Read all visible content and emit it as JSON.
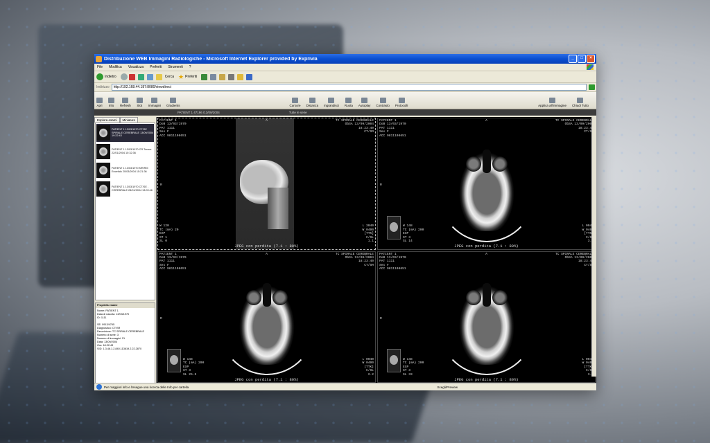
{
  "window": {
    "title": "Distribuzione WEB Immagini Radiologiche - Microsoft Internet Explorer provided by Exprivia"
  },
  "menu": [
    "File",
    "Modifica",
    "Visualizza",
    "Preferiti",
    "Strumenti",
    "?"
  ],
  "nav": {
    "back": "Indietro",
    "search": "Cerca",
    "favorites": "Preferiti"
  },
  "address": {
    "label": "Indirizzo",
    "url": "http://192.168.44.187:8080/viewdirect"
  },
  "viewer_toolbar": {
    "left": [
      "Apri",
      "Info",
      "Refresh",
      "Slot",
      "Immagini",
      "Gradients"
    ],
    "center": [
      "Cursore",
      "Distanza",
      "Ingrandisci",
      "Ruota",
      "Autoplay",
      "Contrasto",
      "Protocolli"
    ],
    "right": [
      "Applica all'immagine",
      "Chiudi Tutto"
    ]
  },
  "strip": {
    "left": "PATIENT 1 47196 /13/09/2004",
    "center": "Tutte le serie"
  },
  "sidebar": {
    "tabs": [
      "Esplora esami",
      "Miniature"
    ],
    "thumbs": [
      {
        "text": "PATIENT 1 13/03/1970 CT/SE SPIRALE CEREBRALE 13/09/2004 19:22:43"
      },
      {
        "text": "PATIENT 1 13/03/1970 CR Torace 22/01/2004 10:32:36"
      },
      {
        "text": "PATIENT 1 13/03/1970 MR/RM Encefalo 20/03/2004 15:21:36"
      },
      {
        "text": "PATIENT 1 13/03/1970 CT/SE - CEREBRALE 28/01/2004 13:09:46"
      }
    ],
    "props_title": "Proprietà esame",
    "props": [
      "Nome: PATIENT 1",
      "Data di nascita: 13/03/1970",
      "ID: 1111",
      "",
      "SE: 0913/4765",
      "Diagnostico: CT/SR",
      "Descrizione: TC SPIRALE CEREBRALE",
      "Numero di serie: 3",
      "Numero di immagini: 21",
      "Data: 13/09/2004",
      "Ora: 18:22:43",
      "SID: 1.3.46.1.2.840.113619.2.22.2870"
    ]
  },
  "viewports": [
    {
      "tl": [
        "PATIENT 1",
        "DoB 13/03/1970",
        "PAT 1111",
        "Sex F",
        "ACC 9811108651"
      ],
      "tr": [
        "TC SPIRALE CEREBRALE",
        "ObSA 13/09/2004",
        "18:23:40",
        "CT/SR"
      ],
      "bl": [
        "W 120",
        "TC (mA) 20",
        "EXP",
        "ST 1",
        "SL 0"
      ],
      "br": [
        "L 3040",
        "W 0400",
        "[TTK]",
        "C/SL",
        "1.1"
      ],
      "bc": "JPEG con perdita (7.1 : 80%)",
      "tc": "A",
      "ml": "R"
    },
    {
      "tl": [
        "PATIENT 1",
        "DoB 13/03/1970",
        "PAT 1111",
        "Sex F",
        "ACC 9811108651"
      ],
      "tr": [
        "TC SPIRALE CEREBRALE",
        "ObSA 13/09/2004",
        "18:23:40",
        "CT/SR"
      ],
      "bl": [
        "W 148",
        "TC (mA) 200",
        "EXP",
        "ST 3",
        "SL 14"
      ],
      "br": [
        "L 0040",
        "W 0400",
        "[TTK]",
        "C/SL",
        "3.1"
      ],
      "bc": "JPEG con perdita (7.1 : 80%)",
      "tc": "A",
      "ml": "R"
    },
    {
      "tl": [
        "PATIENT 1",
        "DoB 13/03/1970",
        "PAT 1111",
        "Sex F",
        "ACC 9811108651"
      ],
      "tr": [
        "TC SPIRALE CEREBRALE",
        "ObSA 13/09/2004",
        "18:23:40",
        "CT/SR"
      ],
      "bl": [
        "W 148",
        "TC (mA) 200",
        "EXP",
        "ST 3",
        "SL 25.5"
      ],
      "br": [
        "L 0040",
        "W 0400",
        "[TTK]",
        "C/SL",
        "2.2"
      ],
      "bc": "JPEG con perdita (7.1 : 80%)",
      "tc": "A",
      "ml": "R"
    },
    {
      "tl": [
        "PATIENT 1",
        "DoB 13/03/1970",
        "PAT 1111",
        "Sex F",
        "ACC 9811108651"
      ],
      "tr": [
        "TC SPIRALE CEREBRALE",
        "ObSA 13/09/2004",
        "18:23:40",
        "CT/SR"
      ],
      "bl": [
        "W 148",
        "TC (mA) 200",
        "EXP",
        "ST 3",
        "SL 33"
      ],
      "br": [
        "L 0040",
        "W 0400",
        "[TTK]",
        "C/SL",
        "3.3"
      ],
      "bc": "JPEG con perdita (7.1 : 80%)",
      "tc": "A",
      "ml": "R"
    }
  ],
  "status": {
    "left": "Per maggiori info e l'esegue una ricerca delle Info per cartella",
    "zone": "Scegli/Preview"
  }
}
